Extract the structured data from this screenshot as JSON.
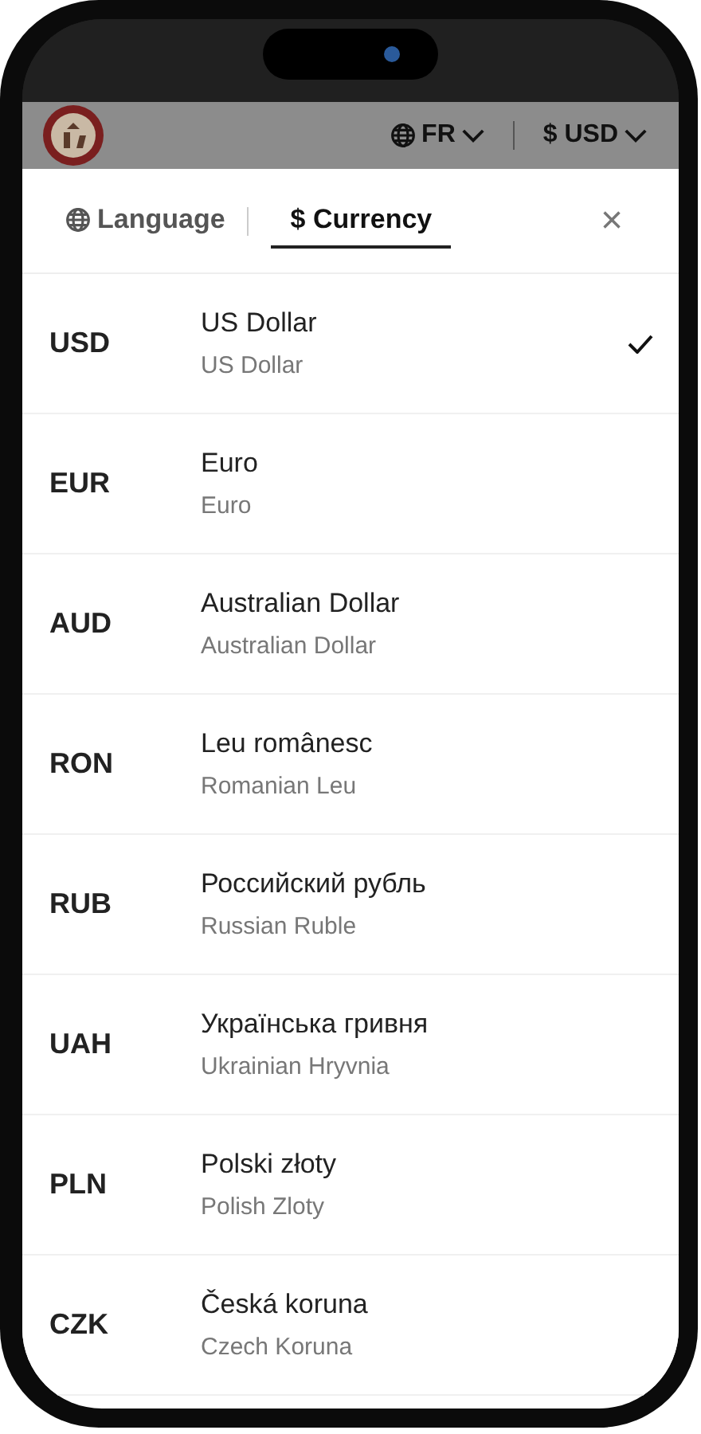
{
  "header": {
    "language_button": "FR",
    "currency_button": "$ USD"
  },
  "tabs": [
    {
      "label": "Language",
      "selected": false
    },
    {
      "label": "$ Currency",
      "selected": true
    }
  ],
  "close_button": "×",
  "currencies": [
    {
      "code": "USD",
      "name": "US Dollar",
      "subtitle": "US Dollar",
      "selected": true
    },
    {
      "code": "EUR",
      "name": "Euro",
      "subtitle": "Euro",
      "selected": false
    },
    {
      "code": "AUD",
      "name": "Australian Dollar",
      "subtitle": "Australian Dollar",
      "selected": false
    },
    {
      "code": "RON",
      "name": "Leu românesc",
      "subtitle": "Romanian Leu",
      "selected": false
    },
    {
      "code": "RUB",
      "name": "Российский рубль",
      "subtitle": "Russian Ruble",
      "selected": false
    },
    {
      "code": "UAH",
      "name": "Українська гривня",
      "subtitle": "Ukrainian Hryvnia",
      "selected": false
    },
    {
      "code": "PLN",
      "name": "Polski złoty",
      "subtitle": "Polish Zloty",
      "selected": false
    },
    {
      "code": "CZK",
      "name": "Česká koruna",
      "subtitle": "Czech Koruna",
      "selected": false
    }
  ]
}
